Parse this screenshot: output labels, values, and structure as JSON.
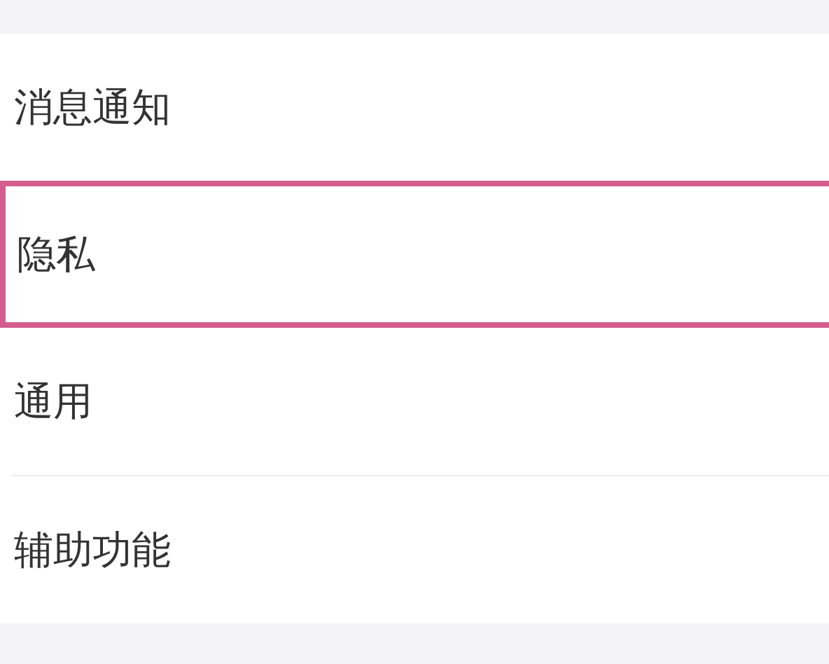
{
  "settings_list": [
    {
      "label": "消息通知",
      "highlighted": false
    },
    {
      "label": "隐私",
      "highlighted": true
    },
    {
      "label": "通用",
      "highlighted": false
    },
    {
      "label": "辅助功能",
      "highlighted": false
    }
  ]
}
